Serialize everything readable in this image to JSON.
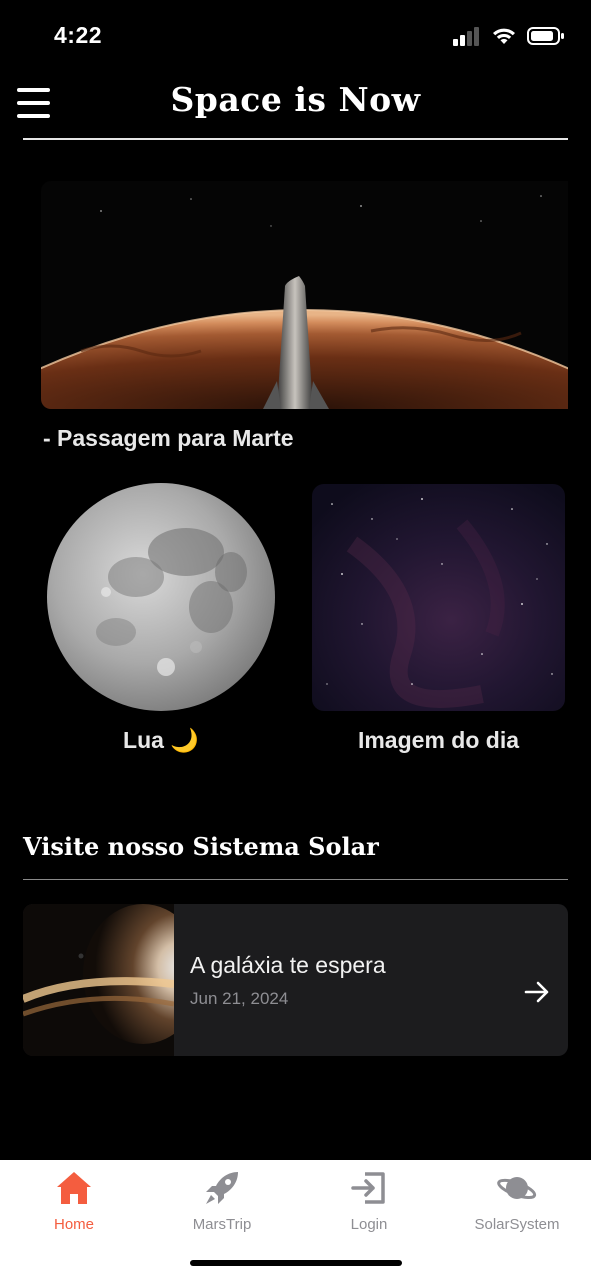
{
  "status_bar": {
    "time": "4:22"
  },
  "header": {
    "title": "Space is Now"
  },
  "featured": {
    "caption": "- Passagem para Marte"
  },
  "cards": {
    "moon_label": "Lua 🌙",
    "image_label": "Imagem do dia"
  },
  "section": {
    "title": "Visite nosso Sistema Solar"
  },
  "post": {
    "title": "A galáxia te espera",
    "date": "Jun 21, 2024"
  },
  "tabs": [
    {
      "label": "Home",
      "icon": "home-icon",
      "active": true
    },
    {
      "label": "MarsTrip",
      "icon": "rocket-icon",
      "active": false
    },
    {
      "label": "Login",
      "icon": "login-icon",
      "active": false
    },
    {
      "label": "SolarSystem",
      "icon": "planet-icon",
      "active": false
    }
  ],
  "colors": {
    "accent": "#f45d3f",
    "background": "#000000",
    "card": "#1c1c1e",
    "tab_inactive": "#8e8e93"
  }
}
